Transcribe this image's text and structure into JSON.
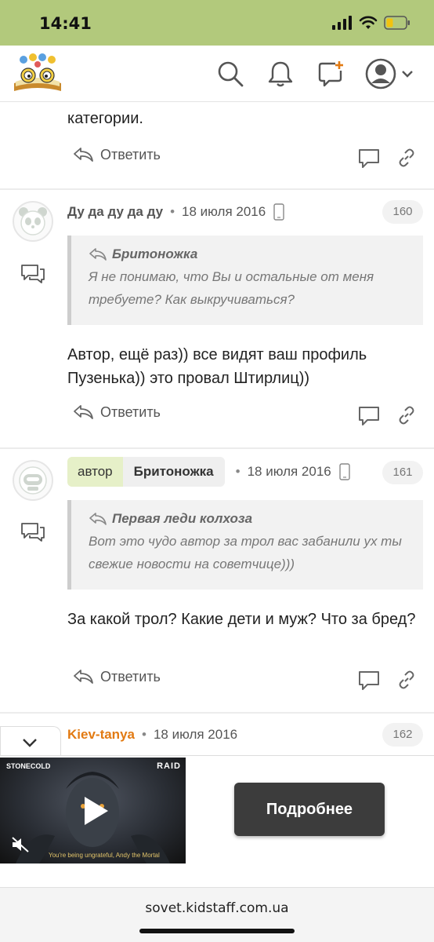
{
  "status_bar": {
    "time": "14:41"
  },
  "header": {
    "logo": "kidstaff-logo",
    "icons": [
      "search-icon",
      "bell-icon",
      "new-post-icon",
      "user-avatar-icon",
      "chevron-down-icon"
    ]
  },
  "partial_comment": {
    "text": "категории.",
    "reply_label": "Ответить"
  },
  "comments": [
    {
      "author": "Ду да ду да ду",
      "date": "18 июля 2016",
      "number": "160",
      "quote_author": "Бритоножка",
      "quote_text": "Я не понимаю, что Вы и остальные от меня требуете? Как выкручиваться?",
      "text": "Автор, ещё раз)) все видят ваш профиль Пузенька)) это провал Штирлиц))",
      "reply_label": "Ответить"
    },
    {
      "badge": "автор",
      "author": "Бритоножка",
      "date": "18 июля 2016",
      "number": "161",
      "quote_author": "Первая леди колхоза",
      "quote_text": "Вот это чудо автор за трол вас забанили ух ты свежие новости на советчице)))",
      "text": "За какой трол? Какие дети и муж? Что за бред?",
      "reply_label": "Ответить"
    },
    {
      "author": "Kiev-tanya",
      "date": "18 июля 2016",
      "number": "162"
    }
  ],
  "ad": {
    "brand_left": "STONECOLD",
    "brand_right": "RAID",
    "caption": "You're being ungrateful, Andy the Mortal",
    "button": "Подробнее"
  },
  "url_bar": {
    "url": "sovet.kidstaff.com.ua"
  },
  "colors": {
    "status_bar": "#b2c97c",
    "author_highlight": "#e27a12",
    "author_badge": "#e6f0c8"
  }
}
